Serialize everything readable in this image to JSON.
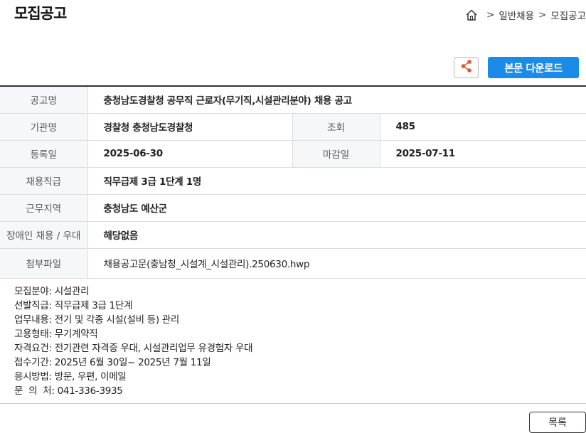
{
  "page": {
    "title": "모집공고"
  },
  "breadcrumb": {
    "home_icon": "home-icon",
    "sep1": ">",
    "item1": "일반채용",
    "sep2": ">",
    "item2": "모집공고"
  },
  "toolbar": {
    "share_icon": "share-icon",
    "download_label": "본문 다운로드"
  },
  "info": {
    "title_label": "공고명",
    "title_value": "충청남도경찰청 공무직 근로자(무기직,시설관리분야) 채용 공고",
    "agency_label": "기관명",
    "agency_value": "경찰청 충청남도경찰청",
    "views_label": "조회",
    "views_value": "485",
    "reg_label": "등록일",
    "reg_value": "2025-06-30",
    "deadline_label": "마감일",
    "deadline_value": "2025-07-11",
    "grade_label": "채용직급",
    "grade_value": "직무급제 3급 1단계 1명",
    "region_label": "근무지역",
    "region_value": "충청남도 예산군",
    "disabled_label": "장애인 채용 / 우대",
    "disabled_value": "해당없음",
    "file_label": "첨부파일",
    "file_value": "채용공고문(충남청_시설계_시설관리).250630.hwp"
  },
  "body": [
    "모집분야: 시설관리",
    "선발직급: 직무급제 3급 1단계",
    "업무내용: 전기 및 각종 시설(설비 등) 관리",
    "고용형태: 무기계약직",
    "자격요건: 전기관련 자격증 우대, 시설관리업무 유경험자 우대",
    "접수기간: 2025년 6월 30일~ 2025년 7월 11일",
    "응시방법: 방문, 우편, 이메일",
    "문  의  처: 041-336-3935"
  ],
  "footer": {
    "list_label": "목록"
  },
  "colors": {
    "accent": "#1a8be8",
    "share_icon": "#e2572b"
  }
}
